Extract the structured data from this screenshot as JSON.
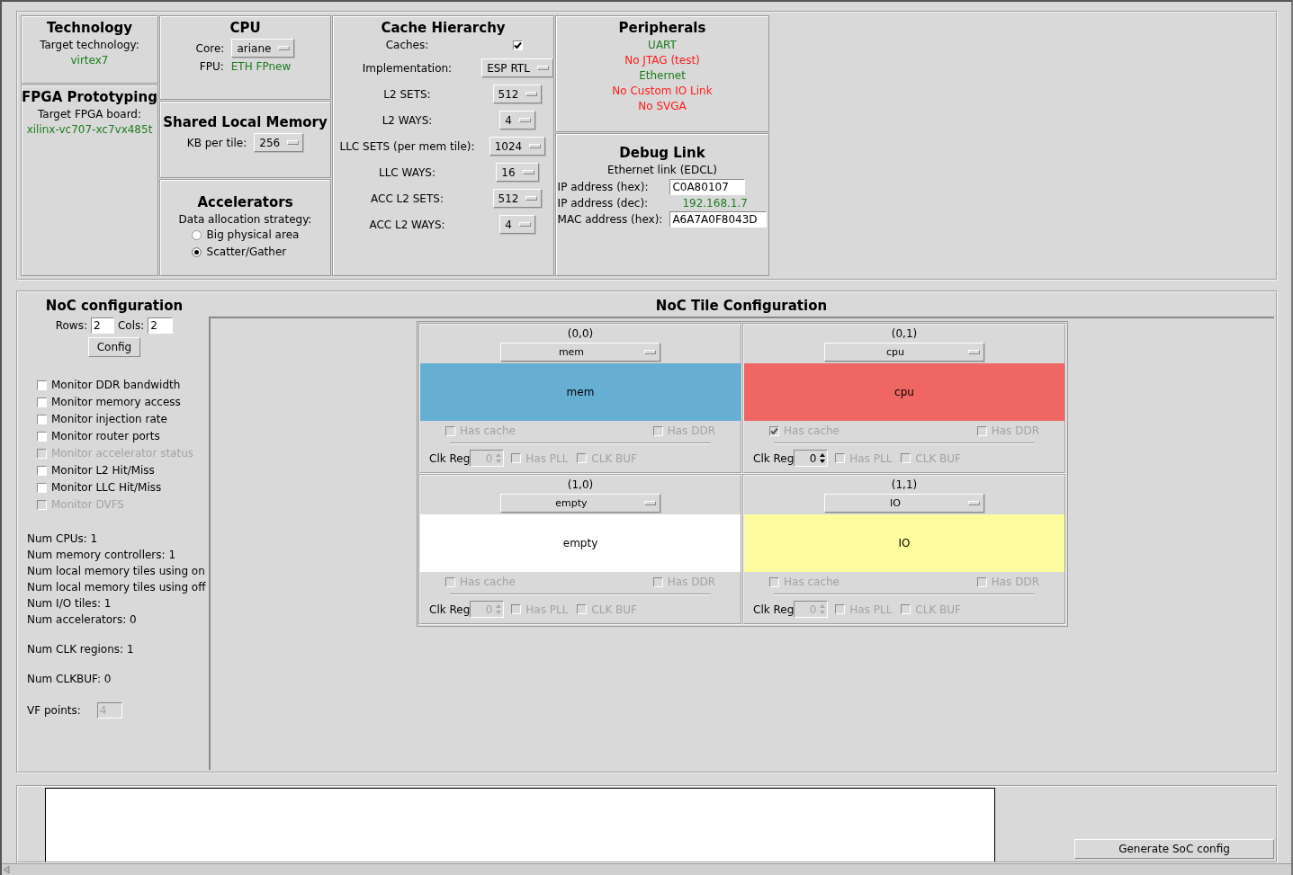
{
  "technology": {
    "title": "Technology",
    "label": "Target technology:",
    "value": "virtex7"
  },
  "fpga": {
    "title": "FPGA Prototyping",
    "label": "Target FPGA board:",
    "value": "xilinx-vc707-xc7vx485t"
  },
  "cpu": {
    "title": "CPU",
    "core_label": "Core:",
    "core": "ariane",
    "fpu_label": "FPU:",
    "fpu": "ETH FPnew"
  },
  "shared_local_memory": {
    "title": "Shared Local Memory",
    "label": "KB per tile:",
    "value": "256"
  },
  "accelerators": {
    "title": "Accelerators",
    "label": "Data allocation strategy:",
    "options": [
      {
        "label": "Big physical area",
        "selected": false
      },
      {
        "label": "Scatter/Gather",
        "selected": true
      }
    ]
  },
  "cache_hierarchy": {
    "title": "Cache Hierarchy",
    "caches_label": "Caches:",
    "caches_checked": true,
    "rows": [
      {
        "label": "Implementation:",
        "value": "ESP RTL"
      },
      {
        "label": "L2 SETS:",
        "value": "512"
      },
      {
        "label": "L2 WAYS:",
        "value": "4"
      },
      {
        "label": "LLC SETS (per mem tile):",
        "value": "1024"
      },
      {
        "label": "LLC WAYS:",
        "value": "16"
      },
      {
        "label": "ACC L2 SETS:",
        "value": "512"
      },
      {
        "label": "ACC L2 WAYS:",
        "value": "4"
      }
    ]
  },
  "peripherals": {
    "title": "Peripherals",
    "items": [
      {
        "label": "UART",
        "enabled": true
      },
      {
        "label": "No JTAG (test)",
        "enabled": false
      },
      {
        "label": "Ethernet",
        "enabled": true
      },
      {
        "label": "No Custom IO Link",
        "enabled": false
      },
      {
        "label": "No SVGA",
        "enabled": false
      }
    ]
  },
  "debug_link": {
    "title": "Debug Link",
    "subtitle": "Ethernet link (EDCL)",
    "fields": [
      {
        "label": "IP address (hex):",
        "value": "C0A80107",
        "kind": "input"
      },
      {
        "label": "IP address (dec):",
        "value": "192.168.1.7",
        "kind": "text"
      },
      {
        "label": "MAC address (hex):",
        "value": "A6A7A0F8043D",
        "kind": "input"
      }
    ]
  },
  "noc_configuration": {
    "title": "NoC configuration",
    "rows_label": "Rows:",
    "rows": "2",
    "cols_label": "Cols:",
    "cols": "2",
    "config_button": "Config",
    "monitors": [
      {
        "label": "Monitor DDR bandwidth",
        "checked": false,
        "disabled": false
      },
      {
        "label": "Monitor memory access",
        "checked": false,
        "disabled": false
      },
      {
        "label": "Monitor injection rate",
        "checked": false,
        "disabled": false
      },
      {
        "label": "Monitor router ports",
        "checked": false,
        "disabled": false
      },
      {
        "label": "Monitor accelerator status",
        "checked": false,
        "disabled": true
      },
      {
        "label": "Monitor L2 Hit/Miss",
        "checked": false,
        "disabled": false
      },
      {
        "label": "Monitor LLC Hit/Miss",
        "checked": false,
        "disabled": false
      },
      {
        "label": "Monitor DVFS",
        "checked": false,
        "disabled": true
      }
    ],
    "stats": [
      [
        "Num CPUs: 1",
        "Num memory controllers: 1",
        "Num local memory tiles using on",
        "Num local memory tiles using off",
        "Num I/O tiles: 1",
        "Num accelerators: 0"
      ],
      [
        "Num CLK regions: 1"
      ],
      [
        "Num CLKBUF: 0"
      ]
    ],
    "vf_label": "VF points:",
    "vf_value": "4"
  },
  "tile_configuration": {
    "title": "NoC Tile Configuration",
    "tiles": [
      {
        "coordinates": "(0,0)",
        "type": "mem",
        "label": "mem",
        "color": "#67aed3",
        "has_cache_label": "Has cache",
        "has_cache": false,
        "has_ddr_label": "Has DDR",
        "has_ddr": false,
        "clk_reg_label": "Clk Reg",
        "clk_reg": "0",
        "clk_reg_enabled": false,
        "has_pll_label": "Has PLL",
        "has_pll": false,
        "clk_buf_label": "CLK BUF",
        "clk_buf": false
      },
      {
        "coordinates": "(0,1)",
        "type": "cpu",
        "label": "cpu",
        "color": "#ef6663",
        "has_cache_label": "Has cache",
        "has_cache": true,
        "has_ddr_label": "Has DDR",
        "has_ddr": false,
        "clk_reg_label": "Clk Reg",
        "clk_reg": "0",
        "clk_reg_enabled": true,
        "has_pll_label": "Has PLL",
        "has_pll": false,
        "clk_buf_label": "CLK BUF",
        "clk_buf": false
      },
      {
        "coordinates": "(1,0)",
        "type": "empty",
        "label": "empty",
        "color": "#ffffff",
        "has_cache_label": "Has cache",
        "has_cache": false,
        "has_ddr_label": "Has DDR",
        "has_ddr": false,
        "clk_reg_label": "Clk Reg",
        "clk_reg": "0",
        "clk_reg_enabled": false,
        "has_pll_label": "Has PLL",
        "has_pll": false,
        "clk_buf_label": "CLK BUF",
        "clk_buf": false
      },
      {
        "coordinates": "(1,1)",
        "type": "IO",
        "label": "IO",
        "color": "#fcfc9f",
        "has_cache_label": "Has cache",
        "has_cache": false,
        "has_ddr_label": "Has DDR",
        "has_ddr": false,
        "clk_reg_label": "Clk Reg",
        "clk_reg": "0",
        "clk_reg_enabled": false,
        "has_pll_label": "Has PLL",
        "has_pll": false,
        "clk_buf_label": "CLK BUF",
        "clk_buf": false
      }
    ]
  },
  "output": {
    "button": "Generate SoC config"
  }
}
